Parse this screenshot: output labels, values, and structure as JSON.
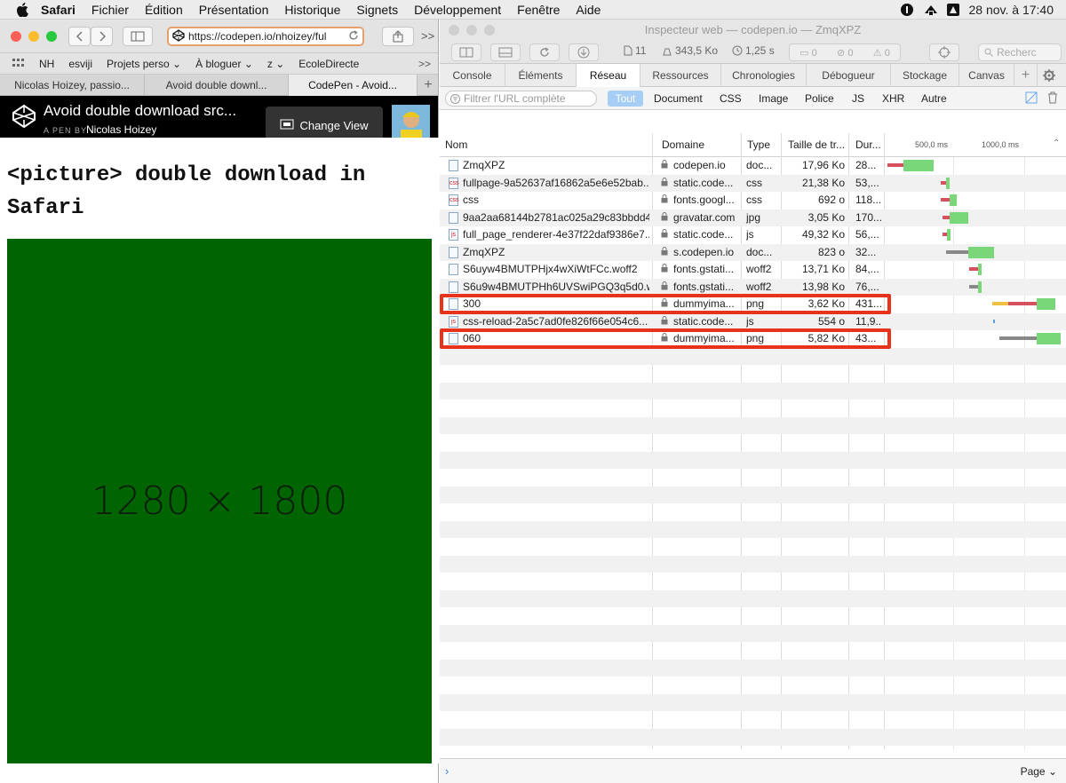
{
  "menubar": {
    "items": [
      "Safari",
      "Fichier",
      "Édition",
      "Présentation",
      "Historique",
      "Signets",
      "Développement",
      "Fenêtre",
      "Aide"
    ],
    "datetime": "28 nov. à 17:40"
  },
  "safari": {
    "url": "https://codepen.io/nhoizey/ful",
    "bookmarks": [
      "NH",
      "esviji",
      "Projets perso ⌄",
      "À bloguer ⌄",
      "z ⌄",
      "EcoleDirecte"
    ],
    "tabs": [
      "Nicolas Hoizey, passio...",
      "Avoid double downl...",
      "CodePen - Avoid..."
    ]
  },
  "codepen": {
    "title": "Avoid double download src...",
    "byline_prefix": "A PEN BY",
    "author": "Nicolas Hoizey",
    "change_view": "Change View"
  },
  "page": {
    "heading": "<picture> double download in Safari",
    "image_text": "1280 × 1800",
    "image_color": "#006400"
  },
  "inspector": {
    "title": "Inspecteur web — codepen.io — ZmqXPZ",
    "stats": {
      "requests": "11",
      "size": "343,5 Ko",
      "time": "1,25 s",
      "errors": "0",
      "warnings": "0",
      "issues": "0"
    },
    "search_placeholder": "Recherc",
    "tabs": [
      "Console",
      "Éléments",
      "Réseau",
      "Ressources",
      "Chronologies",
      "Débogueur",
      "Stockage",
      "Canvas"
    ],
    "filter_placeholder": "Filtrer l'URL complète",
    "filter_types": [
      "Tout",
      "Document",
      "CSS",
      "Image",
      "Police",
      "JS",
      "XHR",
      "Autre"
    ],
    "columns": [
      "Nom",
      "Domaine",
      "Type",
      "Taille de tr...",
      "Dur..."
    ],
    "ticks": [
      "500,0 ms",
      "1000,0 ms"
    ],
    "rows": [
      {
        "name": "ZmqXPZ",
        "domain": "codepen.io",
        "type": "doc...",
        "size": "17,96 Ko",
        "dur": "28...",
        "icon": "doc",
        "bar": [
          4,
          22,
          "#d65060",
          22,
          56,
          "#79d77a"
        ]
      },
      {
        "name": "fullpage-9a52637af16862a5e6e52bab...",
        "domain": "static.code...",
        "type": "css",
        "size": "21,38 Ko",
        "dur": "53,...",
        "icon": "css",
        "bar": [
          64,
          70,
          "#d65060",
          70,
          74,
          "#79d77a"
        ]
      },
      {
        "name": "css",
        "domain": "fonts.googl...",
        "type": "css",
        "size": "692 o",
        "dur": "118...",
        "icon": "css",
        "bar": [
          64,
          74,
          "#d65060",
          74,
          82,
          "#79d77a"
        ]
      },
      {
        "name": "9aa2aa68144b2781ac025a29c83bbdd4",
        "domain": "gravatar.com",
        "type": "jpg",
        "size": "3,05 Ko",
        "dur": "170...",
        "icon": "img",
        "bar": [
          66,
          74,
          "#d65060",
          74,
          95,
          "#79d77a"
        ]
      },
      {
        "name": "full_page_renderer-4e37f22daf9386e7...",
        "domain": "static.code...",
        "type": "js",
        "size": "49,32 Ko",
        "dur": "56,...",
        "icon": "js",
        "bar": [
          66,
          71,
          "#d65060",
          71,
          75,
          "#79d77a"
        ]
      },
      {
        "name": "ZmqXPZ",
        "domain": "s.codepen.io",
        "type": "doc...",
        "size": "823 o",
        "dur": "32...",
        "icon": "doc",
        "bar": [
          70,
          95,
          "#888888",
          95,
          124,
          "#79d77a"
        ]
      },
      {
        "name": "S6uyw4BMUTPHjx4wXiWtFCc.woff2",
        "domain": "fonts.gstati...",
        "type": "woff2",
        "size": "13,71 Ko",
        "dur": "84,...",
        "icon": "font",
        "bar": [
          96,
          106,
          "#d65060",
          106,
          110,
          "#79d77a"
        ]
      },
      {
        "name": "S6u9w4BMUTPHh6UVSwiPGQ3q5d0.w...",
        "domain": "fonts.gstati...",
        "type": "woff2",
        "size": "13,98 Ko",
        "dur": "76,...",
        "icon": "font",
        "bar": [
          96,
          106,
          "#888888",
          106,
          110,
          "#79d77a"
        ]
      },
      {
        "name": "300",
        "domain": "dummyima...",
        "type": "png",
        "size": "3,62 Ko",
        "dur": "431...",
        "icon": "img",
        "bar": [
          122,
          140,
          "#f0c040",
          140,
          172,
          "#d65060",
          172,
          193,
          "#79d77a"
        ]
      },
      {
        "name": "css-reload-2a5c7ad0fe826f66e054c6...",
        "domain": "static.code...",
        "type": "js",
        "size": "554 o",
        "dur": "11,9...",
        "icon": "js",
        "bar": [
          123,
          125,
          "#58a0e0"
        ]
      },
      {
        "name": "060",
        "domain": "dummyima...",
        "type": "png",
        "size": "5,82 Ko",
        "dur": "43...",
        "icon": "img",
        "bar": [
          130,
          172,
          "#888888",
          172,
          199,
          "#79d77a"
        ]
      }
    ],
    "footer_page": "Page ⌄"
  }
}
